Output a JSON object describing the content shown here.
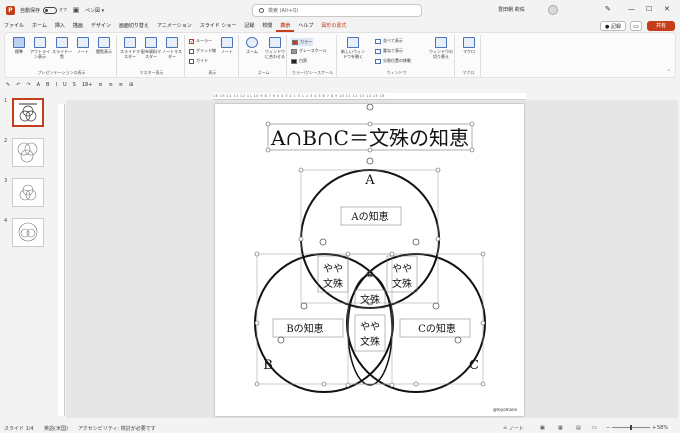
{
  "titlebar": {
    "app_letter": "P",
    "autosave_label": "自動保存",
    "autosave_state": "オフ",
    "doc_name": "ペン図 ▾",
    "search_placeholder": "検索 (Alt+Q)",
    "user_name": "豊田朝 莉佑"
  },
  "tabs": [
    "ファイル",
    "ホーム",
    "挿入",
    "描画",
    "デザイン",
    "画面切り替え",
    "アニメーション",
    "スライド ショー",
    "記録",
    "校閲",
    "表示",
    "ヘルプ",
    "図形の書式"
  ],
  "active_tab": "表示",
  "context_tab": "図形の書式",
  "tab_actions": {
    "record": "● 記録",
    "share": "共有"
  },
  "ribbon": {
    "groups": [
      {
        "label": "プレゼンテーションの表示",
        "buttons": [
          "標準",
          "アウトライン表示",
          "スライド一覧",
          "ノート",
          "閲覧表示"
        ]
      },
      {
        "label": "マスター表示",
        "buttons": [
          "スライドマスター",
          "配布資料マスター",
          "ノートマスター"
        ]
      },
      {
        "label": "表示",
        "checks": [
          {
            "label": "ルーラー",
            "on": true
          },
          {
            "label": "グリッド線",
            "on": false
          },
          {
            "label": "ガイド",
            "on": false
          }
        ],
        "buttons": [
          "ノート"
        ]
      },
      {
        "label": "ズーム",
        "buttons": [
          "ズーム",
          "ウィンドウに合わせる"
        ]
      },
      {
        "label": "カラー/グレースケール",
        "swatches": [
          {
            "label": "カラー",
            "color": "#c43e1c"
          },
          {
            "label": "グレースケール",
            "color": "#999999"
          },
          {
            "label": "白黒",
            "color": "#222222"
          }
        ]
      },
      {
        "label": "ウィンドウ",
        "buttons": [
          "新しいウィンドウを開く"
        ],
        "small": [
          "並べて表示",
          "重ねて表示",
          "分割位置の移動"
        ],
        "buttons2": [
          "ウィンドウの切り替え"
        ]
      },
      {
        "label": "マクロ",
        "buttons": [
          "マクロ"
        ]
      }
    ]
  },
  "fmtbar": [
    "✎",
    "↶",
    "↷",
    "A",
    "B",
    "I",
    "U",
    "S",
    "18+",
    "≡",
    "≡",
    "≡",
    "⊞"
  ],
  "thumbnails": [
    {
      "num": "1",
      "current": true
    },
    {
      "num": "2",
      "current": false
    },
    {
      "num": "3",
      "current": false
    },
    {
      "num": "4",
      "current": false
    }
  ],
  "ruler_top": "16 15 14 13 12 11 10 9 8 7 6 5 4 3 2 1 0 1 2 3 4 5 6 7 8 9 10 11 12 13 14 15 16",
  "slide": {
    "title": "A∩B∩C＝文殊の知恵",
    "label_a": "A",
    "label_b": "B",
    "label_c": "C",
    "a_box": "Aの知恵",
    "b_box": "Bの知恵",
    "c_box": "Cの知恵",
    "ab_line1": "やや",
    "ab_line2": "文殊",
    "ac_line1": "やや",
    "ac_line2": "文殊",
    "bc_line1": "やや",
    "bc_line2": "文殊",
    "center": "文殊",
    "credit": "@toyomane"
  },
  "status": {
    "slide": "スライド 1/4",
    "lang": "英語(米国)",
    "accessibility": "アクセシビリティ: 検討が必要です",
    "notes": "≟ ノート",
    "zoom": "58%"
  }
}
